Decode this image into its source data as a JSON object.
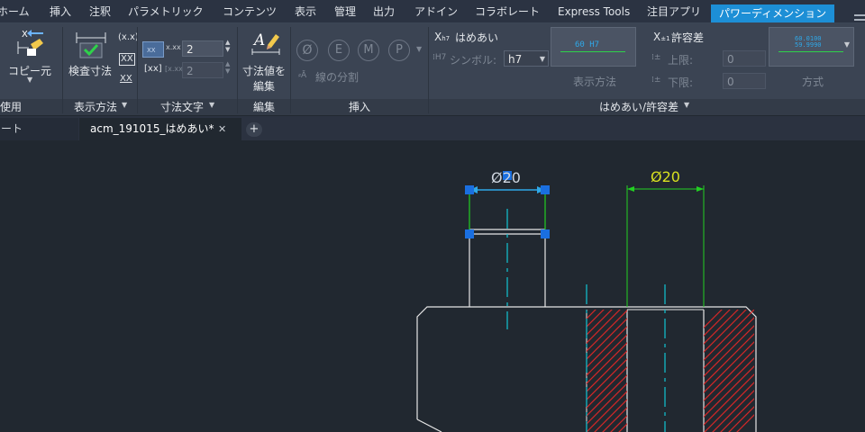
{
  "menu": {
    "items": [
      "ホーム",
      "挿入",
      "注釈",
      "パラメトリック",
      "コンテンツ",
      "表示",
      "管理",
      "出力",
      "アドイン",
      "コラボレート",
      "Express Tools",
      "注目アプリ",
      "パワーディメンション"
    ],
    "active_index": 12
  },
  "ribbon": {
    "reuse": {
      "copy_label": "コピー元",
      "panel_title": "再使用"
    },
    "display": {
      "inspect_label": "検査寸法",
      "xx_paren": "(x.x)",
      "xx_box": "XX",
      "xx_under": "XX",
      "panel_title": "表示方法"
    },
    "dim_text": {
      "precision_value": "2",
      "alt_precision_value": "2",
      "bracket_label": "[xx]",
      "panel_title": "寸法文字"
    },
    "edit": {
      "edit_label_1": "寸法値を",
      "edit_label_2": "編集",
      "panel_title": "編集"
    },
    "insert": {
      "split_label": "線の分割",
      "panel_title": "挿入",
      "symbols": [
        "Ø",
        "E",
        "M",
        "P"
      ]
    },
    "fit": {
      "title": "はめあい",
      "symbol_label": "シンボル:",
      "symbol_value": "h7",
      "preview_text": "60 H7",
      "display_method_label": "表示方法",
      "tol_title": "許容差",
      "upper_label": "上限:",
      "upper_value": "0",
      "lower_label": "下限:",
      "lower_value": "0",
      "tol_preview_upper": "60.0100",
      "tol_preview_lower": "59.9990",
      "method_label": "方式",
      "panel_title": "はめあい/許容差"
    }
  },
  "tabs": {
    "left_partial": "ート",
    "active": "acm_191015_はめあい*",
    "close": "✕",
    "add": "+"
  },
  "drawing": {
    "dim_left": "Ø20",
    "dim_right": "Ø20"
  },
  "colors": {
    "accent": "#1d8fd6",
    "dim_green": "#22d022",
    "cyan_center": "#11c4d4",
    "hatch_red": "#d42828",
    "grip_blue": "#1a6fe0",
    "dim_text_yellow": "#d8e020"
  }
}
